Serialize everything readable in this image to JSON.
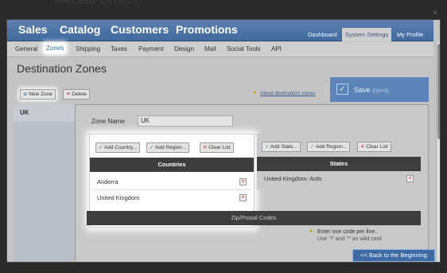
{
  "background_title": "Recent Orders",
  "main_nav": [
    "Sales",
    "Catalog",
    "Customers",
    "Promotions"
  ],
  "top_tabs": [
    "Dashboard",
    "System Settings",
    "My Profile"
  ],
  "sub_nav": [
    "General",
    "Zones",
    "Shipping",
    "Taxes",
    "Payment",
    "Design",
    "Mail",
    "Social Tools",
    "API"
  ],
  "page_title": "Destination Zones",
  "toolbar": {
    "new_zone": "New Zone",
    "delete": "Delete",
    "about": "About destination zones"
  },
  "save": {
    "label": "Save",
    "shortcut": "(Ctrl+S)"
  },
  "zone_list": [
    "UK"
  ],
  "zone_name_label": "Zone Name",
  "zone_name_value": "UK",
  "countries": {
    "buttons": [
      "Add Country...",
      "Add Region...",
      "Clear List"
    ],
    "header": "Countries",
    "items": [
      "Andorra",
      "United Kingdom"
    ]
  },
  "states": {
    "buttons": [
      "Add State...",
      "Add Region...",
      "Clear List"
    ],
    "header": "States",
    "items": [
      "United Kingdom: Ards"
    ]
  },
  "zip_header": "Zip/Postal Codes",
  "zip_note_1": "Enter one code per line.",
  "zip_note_2": "Use '?' and '*' as wild card",
  "back_button": "<< Back to the Beginning",
  "colors": {
    "accent": "#416a9f",
    "header_dark": "#3d3d3d",
    "save_blue": "#5d84b8"
  }
}
